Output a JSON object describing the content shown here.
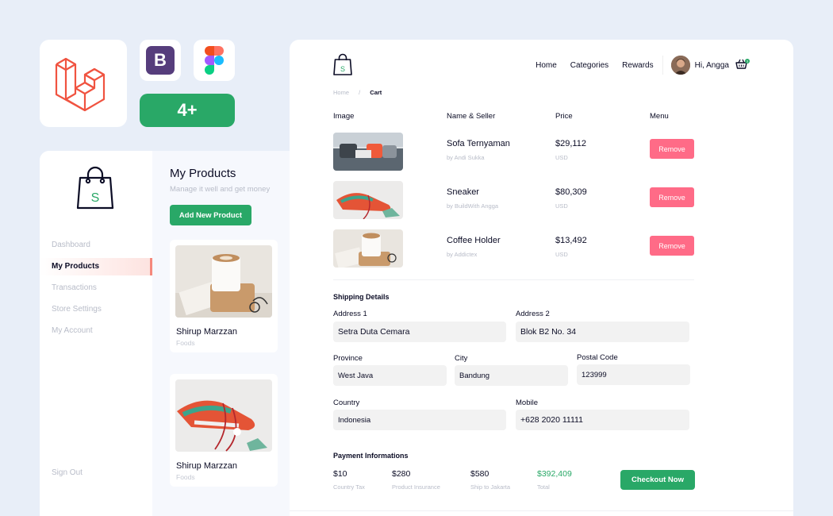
{
  "badges": {
    "more": "4+"
  },
  "colors": {
    "brand_green": "#29a867",
    "remove_pink": "#ff6b87",
    "laravel_red": "#f05340",
    "bootstrap_purple": "#563d7c"
  },
  "icons": [
    "laravel-logo",
    "bootstrap-logo",
    "figma-logo",
    "shopping-bag-icon",
    "basket-icon"
  ],
  "dashboard": {
    "logo_letter": "S",
    "nav": [
      "Dashboard",
      "My Products",
      "Transactions",
      "Store Settings",
      "My Account"
    ],
    "active_nav": "My Products",
    "sign_out": "Sign Out",
    "title": "My Products",
    "subtitle": "Manage it well and get money",
    "add_button": "Add New Product",
    "products": [
      {
        "name": "Shirup Marzzan",
        "category": "Foods"
      },
      {
        "name": "Shirup Marzzan",
        "category": "Foods"
      }
    ]
  },
  "cart": {
    "logo_letter": "S",
    "nav": {
      "home": "Home",
      "categories": "Categories",
      "rewards": "Rewards",
      "greeting": "Hi, Angga",
      "cart_count": "3"
    },
    "breadcrumb": {
      "home": "Home",
      "sep": "/",
      "current": "Cart"
    },
    "columns": {
      "image": "Image",
      "name": "Name & Seller",
      "price": "Price",
      "menu": "Menu"
    },
    "items": [
      {
        "name": "Sofa Ternyaman",
        "seller": "by Andi Sukka",
        "price": "$29,112",
        "currency": "USD",
        "action": "Remove"
      },
      {
        "name": "Sneaker",
        "seller": "by BuildWith Angga",
        "price": "$80,309",
        "currency": "USD",
        "action": "Remove"
      },
      {
        "name": "Coffee Holder",
        "seller": "by Addictex",
        "price": "$13,492",
        "currency": "USD",
        "action": "Remove"
      }
    ],
    "shipping": {
      "title": "Shipping Details",
      "address1_label": "Address 1",
      "address1": "Setra Duta Cemara",
      "address2_label": "Address 2",
      "address2": "Blok B2 No. 34",
      "province_label": "Province",
      "province": "West Java",
      "city_label": "City",
      "city": "Bandung",
      "postal_label": "Postal Code",
      "postal": "123999",
      "country_label": "Country",
      "country": "Indonesia",
      "mobile_label": "Mobile",
      "mobile": "+628 2020 11111"
    },
    "payment": {
      "title": "Payment Informations",
      "country_tax": "$10",
      "country_tax_label": "Country Tax",
      "insurance": "$280",
      "insurance_label": "Product Insurance",
      "shipping": "$580",
      "shipping_label": "Ship to Jakarta",
      "total": "$392,409",
      "total_label": "Total",
      "checkout": "Checkout Now"
    }
  }
}
